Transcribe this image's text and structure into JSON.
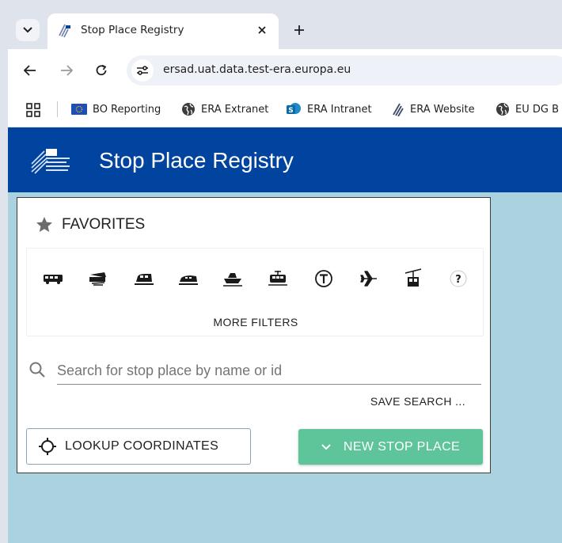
{
  "browser": {
    "tab_title": "Stop Place Registry",
    "url": "ersad.uat.data.test-era.europa.eu",
    "bookmarks": [
      {
        "label": "BO Reporting",
        "icon": "eu-flag-icon"
      },
      {
        "label": "ERA Extranet",
        "icon": "globe-icon"
      },
      {
        "label": "ERA Intranet",
        "icon": "sharepoint-icon"
      },
      {
        "label": "ERA Website",
        "icon": "era-logo-icon"
      },
      {
        "label": "EU DG B",
        "icon": "globe-icon"
      }
    ]
  },
  "app": {
    "title": "Stop Place Registry",
    "header_color": "#0044a0",
    "map_color": "#aad3df"
  },
  "panel": {
    "favorites_label": "FAVORITES",
    "transport_modes": [
      "bus-icon",
      "coach-icon",
      "rail-icon",
      "metro-icon",
      "ferry-icon",
      "tram-icon",
      "taxi-icon",
      "airplane-icon",
      "cable-car-icon",
      "unknown-mode-icon"
    ],
    "more_filters_label": "MORE FILTERS",
    "search_placeholder": "Search for stop place by name or id",
    "search_value": "",
    "save_search_label": "SAVE SEARCH ...",
    "lookup_coordinates_label": "LOOKUP COORDINATES",
    "new_stop_place_label": "NEW STOP PLACE",
    "accent_color": "#5ec49a"
  }
}
